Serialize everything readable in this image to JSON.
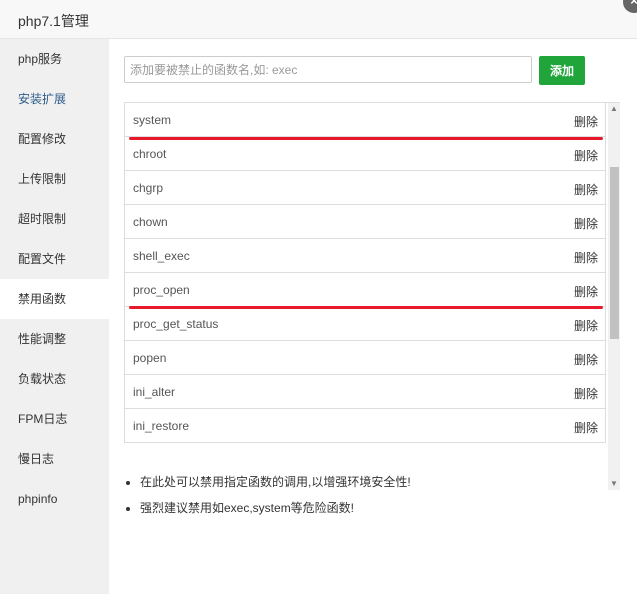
{
  "window": {
    "title": "php7.1管理",
    "close_symbol": "×"
  },
  "sidebar": {
    "items": [
      {
        "label": "php服务"
      },
      {
        "label": "安装扩展"
      },
      {
        "label": "配置修改"
      },
      {
        "label": "上传限制"
      },
      {
        "label": "超时限制"
      },
      {
        "label": "配置文件"
      },
      {
        "label": "禁用函数"
      },
      {
        "label": "性能调整"
      },
      {
        "label": "负载状态"
      },
      {
        "label": "FPM日志"
      },
      {
        "label": "慢日志"
      },
      {
        "label": "phpinfo"
      }
    ],
    "active_index": 6
  },
  "form": {
    "placeholder": "添加要被禁止的函数名,如: exec",
    "value": "",
    "add_label": "添加"
  },
  "functions": {
    "delete_label": "删除",
    "rows": [
      {
        "name": "system",
        "highlighted": true
      },
      {
        "name": "chroot",
        "highlighted": false
      },
      {
        "name": "chgrp",
        "highlighted": false
      },
      {
        "name": "chown",
        "highlighted": false
      },
      {
        "name": "shell_exec",
        "highlighted": false
      },
      {
        "name": "proc_open",
        "highlighted": true
      },
      {
        "name": "proc_get_status",
        "highlighted": false
      },
      {
        "name": "popen",
        "highlighted": false
      },
      {
        "name": "ini_alter",
        "highlighted": false
      },
      {
        "name": "ini_restore",
        "highlighted": false
      }
    ],
    "highlight_color": "#e8192c"
  },
  "notes": [
    "在此处可以禁用指定函数的调用,以增强环境安全性!",
    "强烈建议禁用如exec,system等危险函数!"
  ],
  "colors": {
    "accent": "#20a53a"
  }
}
